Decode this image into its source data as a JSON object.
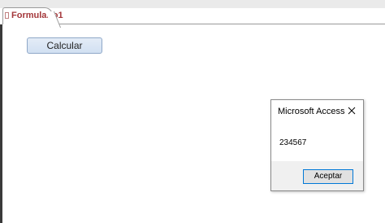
{
  "tab": {
    "label": "Formulario1"
  },
  "form": {
    "calcular_label": "Calcular"
  },
  "dialog": {
    "title": "Microsoft Access",
    "message": "234567",
    "ok_label": "Aceptar"
  },
  "icons": {
    "tab": "form-icon",
    "close": "close-icon"
  },
  "colors": {
    "tab_text": "#a4373a",
    "ok_border": "#0078d7"
  }
}
